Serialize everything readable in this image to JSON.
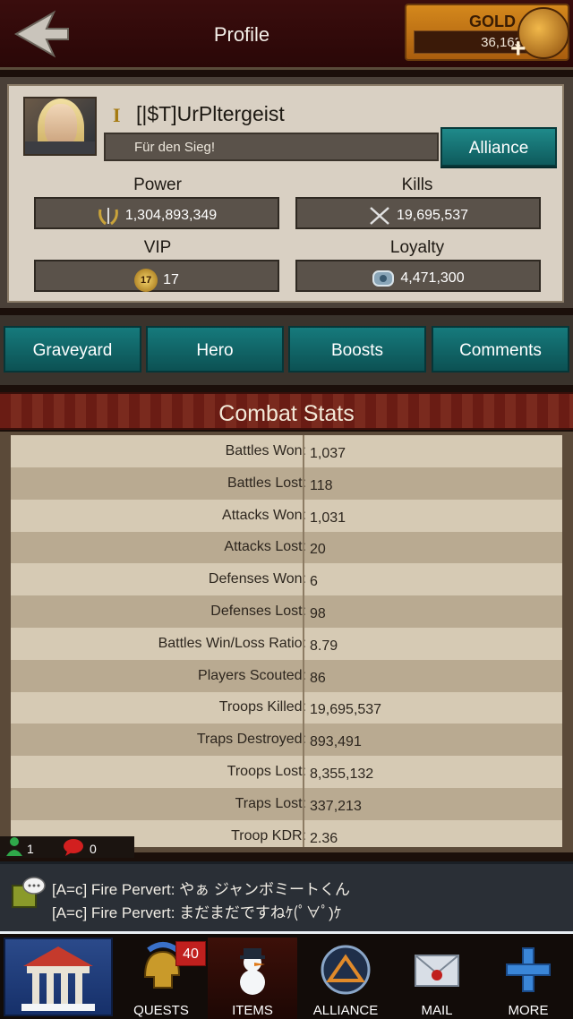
{
  "header": {
    "title": "Profile",
    "gold_label": "GOLD",
    "gold_value": "36,163"
  },
  "profile": {
    "rank_badge": "I",
    "name": "[|$T]UrPltergeist",
    "motto": "Für den Sieg!",
    "alliance_label": "Alliance",
    "power_label": "Power",
    "power_value": "1,304,893,349",
    "kills_label": "Kills",
    "kills_value": "19,695,537",
    "vip_label": "VIP",
    "vip_value": "17",
    "vip_badge": "17",
    "loyalty_label": "Loyalty",
    "loyalty_value": "4,471,300"
  },
  "tabs": [
    "Graveyard",
    "Hero",
    "Boosts",
    "Comments"
  ],
  "combat": {
    "title": "Combat Stats",
    "rows": [
      {
        "label": "Battles Won:",
        "value": "1,037"
      },
      {
        "label": "Battles Lost:",
        "value": "118"
      },
      {
        "label": "Attacks Won:",
        "value": "1,031"
      },
      {
        "label": "Attacks Lost:",
        "value": "20"
      },
      {
        "label": "Defenses Won:",
        "value": "6"
      },
      {
        "label": "Defenses Lost:",
        "value": "98"
      },
      {
        "label": "Battles Win/Loss Ratio:",
        "value": "8.79"
      },
      {
        "label": "Players Scouted:",
        "value": "86"
      },
      {
        "label": "Troops Killed:",
        "value": "19,695,537"
      },
      {
        "label": "Traps Destroyed:",
        "value": "893,491"
      },
      {
        "label": "Troops Lost:",
        "value": "8,355,132"
      },
      {
        "label": "Traps Lost:",
        "value": "337,213"
      },
      {
        "label": "Troop KDR:",
        "value": "2.36"
      }
    ]
  },
  "online": {
    "members": "1",
    "messages": "0"
  },
  "chat": {
    "line1": "[A=c] Fire Pervert: やぁ ジャンボミートくん",
    "line2": "[A=c] Fire Pervert: まだまだですねｹ(ﾟ∀ﾟ)ｹ"
  },
  "nav": {
    "quests_label": "QUESTS",
    "quests_badge": "40",
    "items_label": "ITEMS",
    "alliance_label": "ALLIANCE",
    "mail_label": "MAIL",
    "more_label": "MORE"
  },
  "colors": {
    "accent_teal": "#167a7c",
    "gold": "#d4881c",
    "header_red": "#3a0d0d"
  }
}
